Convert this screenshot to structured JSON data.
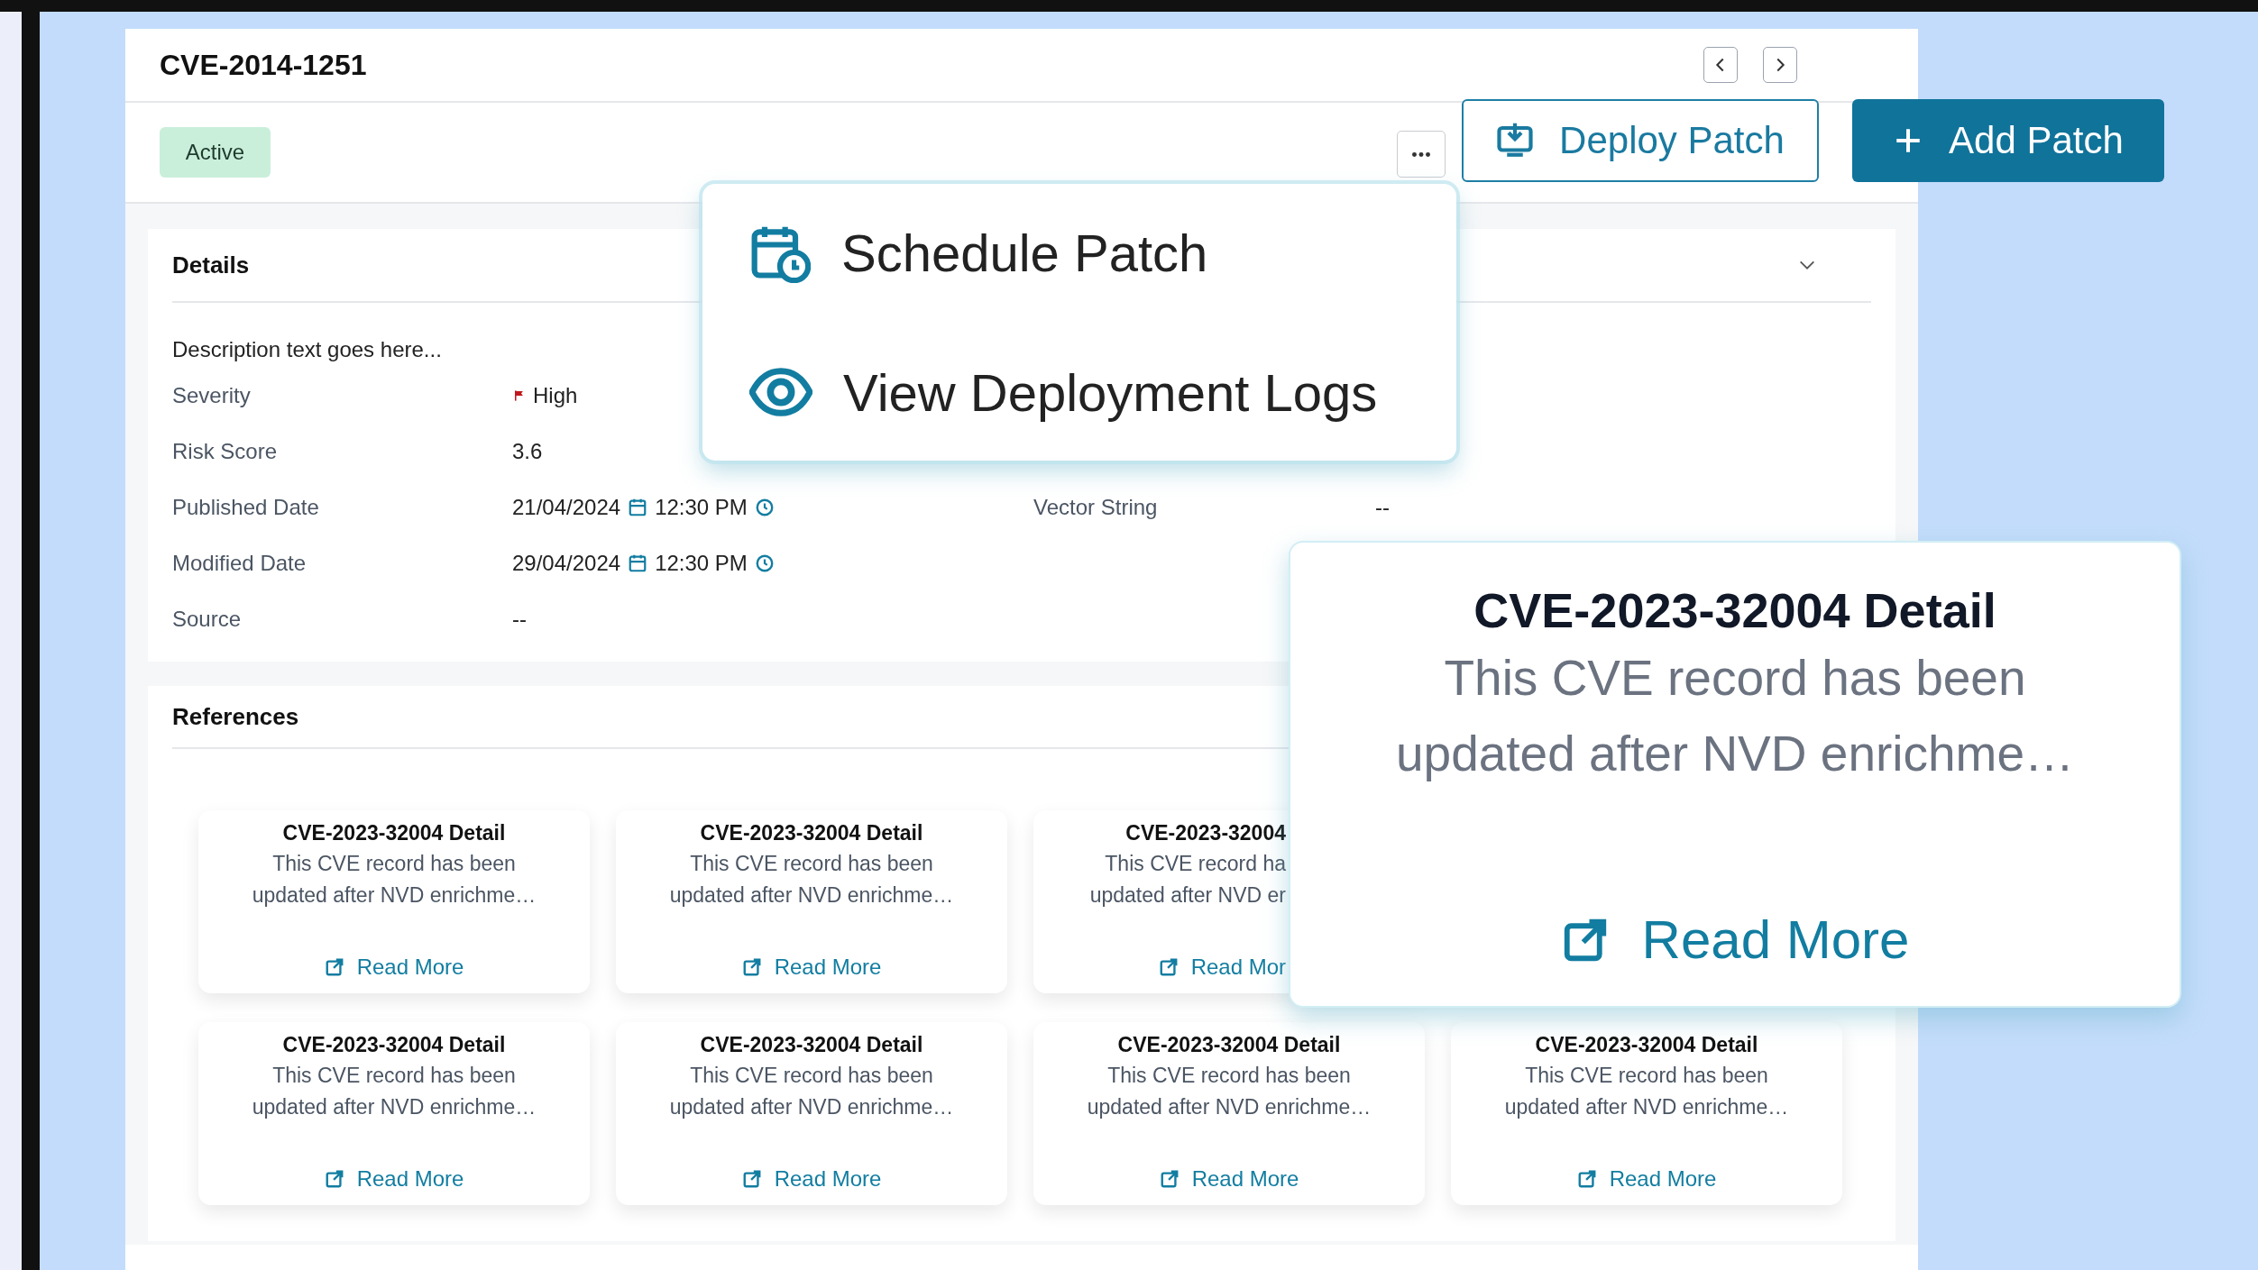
{
  "record": {
    "title": "CVE-2014-1251",
    "status": "Active"
  },
  "buttons": [
    {
      "label": "Deploy Patch",
      "kind": "deploy"
    },
    {
      "label": "Add Patch",
      "kind": "add"
    }
  ],
  "menu": {
    "items": [
      {
        "label": "Schedule Patch",
        "kind": "schedule"
      },
      {
        "label": "View Deployment Logs",
        "kind": "view"
      }
    ]
  },
  "details": {
    "title": "Details",
    "description": "Description text goes here...",
    "rows": [
      [
        {
          "label": "Severity",
          "kind": "severity",
          "value": "High"
        }
      ],
      [
        {
          "label": "Risk Score",
          "kind": "text",
          "value": "3.6"
        }
      ],
      [
        {
          "label": "Published Date",
          "kind": "datetime",
          "date": "21/04/2024",
          "time": "12:30 PM"
        },
        {
          "label": "Vector String",
          "kind": "text",
          "value": "--"
        }
      ],
      [
        {
          "label": "Modified Date",
          "kind": "datetime",
          "date": "29/04/2024",
          "time": "12:30 PM"
        }
      ],
      [
        {
          "label": "Source",
          "kind": "text",
          "value": "--"
        }
      ]
    ]
  },
  "references": {
    "title": "References",
    "rows": [
      [
        {
          "kind": "full",
          "title": "CVE-2023-32004 Detail",
          "lines": [
            "This CVE record has been",
            "updated after NVD enrichme…"
          ],
          "link": "Read More"
        },
        {
          "kind": "full",
          "title": "CVE-2023-32004 Detail",
          "lines": [
            "This CVE record has been",
            "updated after NVD enrichme…"
          ],
          "link": "Read More"
        },
        {
          "kind": "clipped",
          "title": "CVE-2023-32004",
          "lines": [
            "This CVE record ha",
            "updated after NVD er"
          ],
          "link": "Read Mor"
        }
      ],
      [
        {
          "kind": "full",
          "title": "CVE-2023-32004 Detail",
          "lines": [
            "This CVE record has been",
            "updated after NVD enrichme…"
          ],
          "link": "Read More"
        },
        {
          "kind": "full",
          "title": "CVE-2023-32004 Detail",
          "lines": [
            "This CVE record has been",
            "updated after NVD enrichme…"
          ],
          "link": "Read More"
        },
        {
          "kind": "full",
          "title": "CVE-2023-32004 Detail",
          "lines": [
            "This CVE record has been",
            "updated after NVD enrichme…"
          ],
          "link": "Read More"
        },
        {
          "kind": "full",
          "title": "CVE-2023-32004 Detail",
          "lines": [
            "This CVE record has been",
            "updated after NVD enrichme…"
          ],
          "link": "Read More"
        }
      ]
    ]
  },
  "popover": {
    "title": "CVE-2023-32004 Detail",
    "lines": [
      "This CVE record has been",
      "updated after NVD enrichme…"
    ],
    "link": "Read More"
  }
}
